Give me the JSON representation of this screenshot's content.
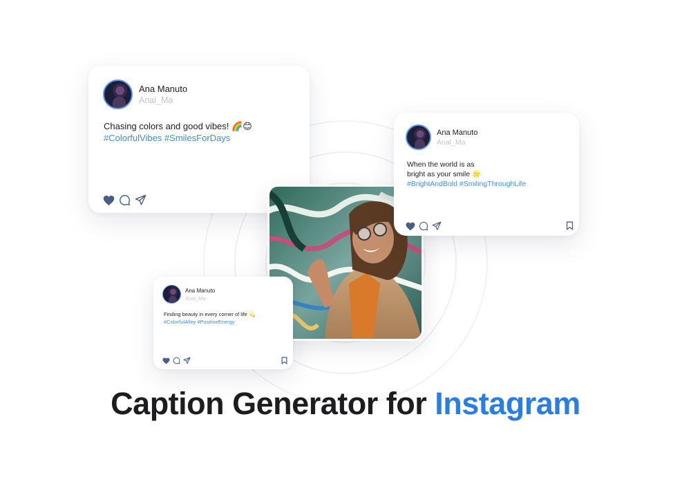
{
  "colors": {
    "accent": "#2a7de1",
    "hashtag": "#3f8fe0",
    "heart": "#4a5d82",
    "text": "#1d1d1f",
    "muted": "#c2c4c9",
    "ring": "#ececef"
  },
  "posts": [
    {
      "name": "Ana Manuto",
      "handle": "Anal_Ma",
      "caption": "Chasing colors and good vibes! 🌈😊",
      "hashtags": "#ColorfulVibes #SmilesForDays",
      "icons": [
        "heart-icon",
        "comment-icon",
        "share-icon",
        "bookmark-icon"
      ]
    },
    {
      "name": "Ana Manuto",
      "handle": "Anal_Ma",
      "caption_line1": "When the world is as",
      "caption_line2": "bright as your smile 🌟",
      "hashtags": "#BrightAndBold #SmilingThroughLife",
      "icons": [
        "heart-icon",
        "comment-icon",
        "share-icon",
        "bookmark-icon"
      ]
    },
    {
      "name": "Ana Manuto",
      "handle": "Anal_Ma",
      "caption": "Finding beauty in every corner of life 💫",
      "hashtags": "#ColorfulAlley #PositiveEnergy",
      "icons": [
        "heart-icon",
        "comment-icon",
        "share-icon",
        "bookmark-icon"
      ]
    }
  ],
  "headline": {
    "main": "Caption Generator for",
    "accent": "Instagram"
  }
}
